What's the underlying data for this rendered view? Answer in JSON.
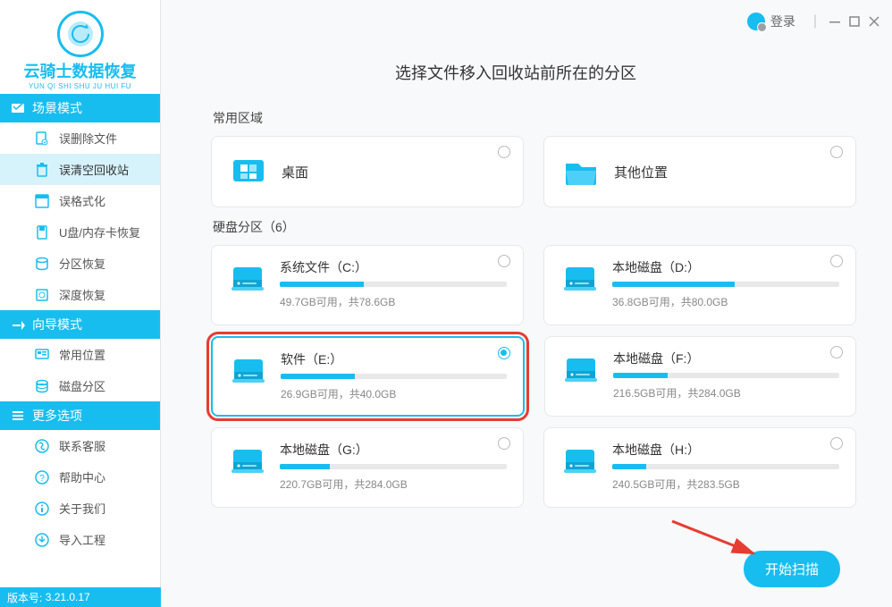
{
  "app": {
    "name": "云骑士数据恢复",
    "name_pinyin": "YUN QI SHI SHU JU HUI FU",
    "version_label": "版本号:",
    "version": "3.21.0.17"
  },
  "titlebar": {
    "login": "登录"
  },
  "sidebar": {
    "section_scene": "场景模式",
    "scene_items": [
      "误删除文件",
      "误清空回收站",
      "误格式化",
      "U盘/内存卡恢复",
      "分区恢复",
      "深度恢复"
    ],
    "section_wizard": "向导模式",
    "wizard_items": [
      "常用位置",
      "磁盘分区"
    ],
    "section_more": "更多选项",
    "more_items": [
      "联系客服",
      "帮助中心",
      "关于我们",
      "导入工程"
    ]
  },
  "main": {
    "title": "选择文件移入回收站前所在的分区",
    "common_label": "常用区域",
    "common_cards": [
      {
        "label": "桌面"
      },
      {
        "label": "其他位置"
      }
    ],
    "disk_label": "硬盘分区（6）",
    "disks": [
      {
        "name": "系统文件（C:）",
        "free": "49.7GB",
        "total": "78.6GB",
        "pct": 37
      },
      {
        "name": "本地磁盘（D:）",
        "free": "36.8GB",
        "total": "80.0GB",
        "pct": 54
      },
      {
        "name": "软件（E:）",
        "free": "26.9GB",
        "total": "40.0GB",
        "pct": 33,
        "selected": true,
        "highlighted": true
      },
      {
        "name": "本地磁盘（F:）",
        "free": "216.5GB",
        "total": "284.0GB",
        "pct": 24
      },
      {
        "name": "本地磁盘（G:）",
        "free": "220.7GB",
        "total": "284.0GB",
        "pct": 22
      },
      {
        "name": "本地磁盘（H:）",
        "free": "240.5GB",
        "total": "283.5GB",
        "pct": 15
      }
    ],
    "scan_button": "开始扫描",
    "size_sep": "可用，共"
  }
}
